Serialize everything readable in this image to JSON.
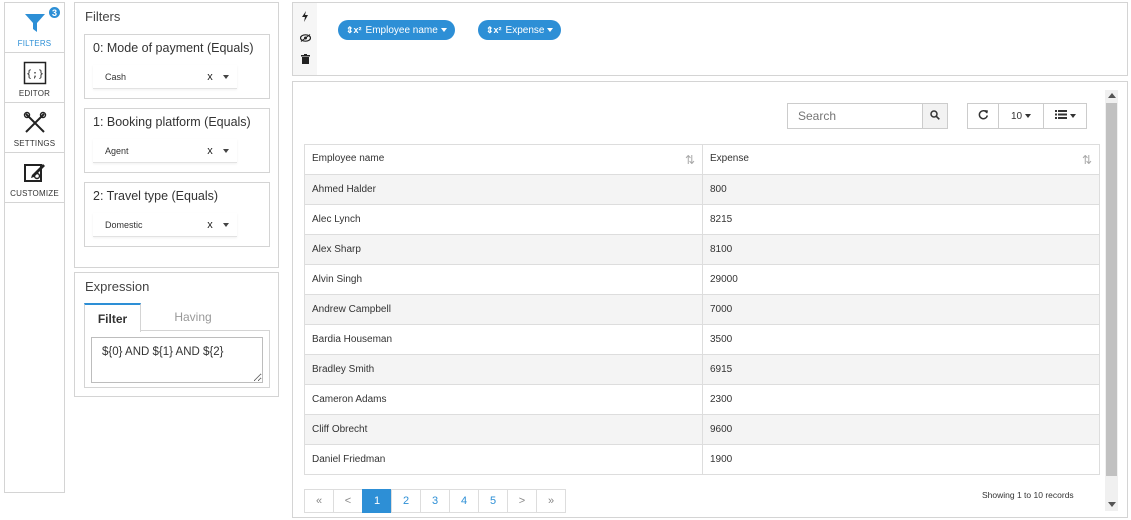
{
  "rail": {
    "items": [
      {
        "label": "FILTERS",
        "badge": "3",
        "icon": "funnel-icon"
      },
      {
        "label": "EDITOR",
        "icon": "braces-icon"
      },
      {
        "label": "SETTINGS",
        "icon": "tools-icon"
      },
      {
        "label": "CUSTOMIZE",
        "icon": "edit-box-icon"
      }
    ]
  },
  "filters": {
    "title": "Filters",
    "items": [
      {
        "title": "0: Mode of payment (Equals)",
        "value": "Cash",
        "clear": "x"
      },
      {
        "title": "1: Booking platform (Equals)",
        "value": "Agent",
        "clear": "x"
      },
      {
        "title": "2: Travel type (Equals)",
        "value": "Domestic",
        "clear": "x"
      }
    ]
  },
  "expression": {
    "title": "Expression",
    "tabs": {
      "filter": "Filter",
      "having": "Having"
    },
    "value": "${0} AND ${1} AND ${2}"
  },
  "chips": [
    {
      "symbol": "⇕x²",
      "label": "Employee name"
    },
    {
      "symbol": "⇕x²",
      "label": "Expense"
    }
  ],
  "table": {
    "search_placeholder": "Search",
    "page_size": "10",
    "columns": [
      "Employee name",
      "Expense"
    ],
    "rows": [
      [
        "Ahmed Halder",
        "800"
      ],
      [
        "Alec Lynch",
        "8215"
      ],
      [
        "Alex Sharp",
        "8100"
      ],
      [
        "Alvin Singh",
        "29000"
      ],
      [
        "Andrew Campbell",
        "7000"
      ],
      [
        "Bardia Houseman",
        "3500"
      ],
      [
        "Bradley Smith",
        "6915"
      ],
      [
        "Cameron Adams",
        "2300"
      ],
      [
        "Cliff Obrecht",
        "9600"
      ],
      [
        "Daniel Friedman",
        "1900"
      ]
    ],
    "pager": {
      "first": "«",
      "prev": "<",
      "pages": [
        "1",
        "2",
        "3",
        "4",
        "5"
      ],
      "next": ">",
      "last": "»"
    },
    "records_text": "Showing 1 to 10 records"
  },
  "colors": {
    "accent": "#2d8fd6"
  }
}
